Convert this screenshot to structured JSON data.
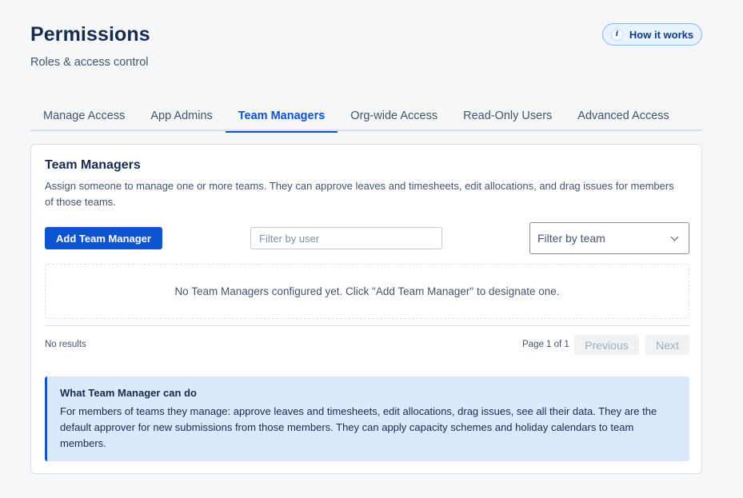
{
  "header": {
    "title": "Permissions",
    "subtitle": "Roles & access control",
    "how_it_works": "How it works",
    "info_icon_glyph": "i"
  },
  "tabs": [
    {
      "label": "Manage Access",
      "active": false
    },
    {
      "label": "App Admins",
      "active": false
    },
    {
      "label": "Team Managers",
      "active": true
    },
    {
      "label": "Org-wide Access",
      "active": false
    },
    {
      "label": "Read-Only Users",
      "active": false
    },
    {
      "label": "Advanced Access",
      "active": false
    }
  ],
  "card": {
    "title": "Team Managers",
    "description": "Assign someone to manage one or more teams. They can approve leaves and timesheets, edit allocations, and drag issues for members of those teams.",
    "add_button": "Add Team Manager",
    "filter_user_placeholder": "Filter by user",
    "filter_team_label": "Filter by team",
    "empty_message": "No Team Managers configured yet. Click \"Add Team Manager\" to designate one.",
    "results_text": "No results",
    "page_info": "Page 1 of 1",
    "previous": "Previous",
    "next": "Next"
  },
  "info_panel": {
    "title": "What Team Manager can do",
    "body": "For members of teams they manage: approve leaves and timesheets, edit allocations, drag issues, see all their data. They are the default approver for new submissions from those members. They can apply capacity schemes and holiday calendars to team members."
  },
  "colors": {
    "accent": "#0c55cf",
    "background": "#f6f7f9",
    "info_panel_bg": "#dce9fc"
  }
}
